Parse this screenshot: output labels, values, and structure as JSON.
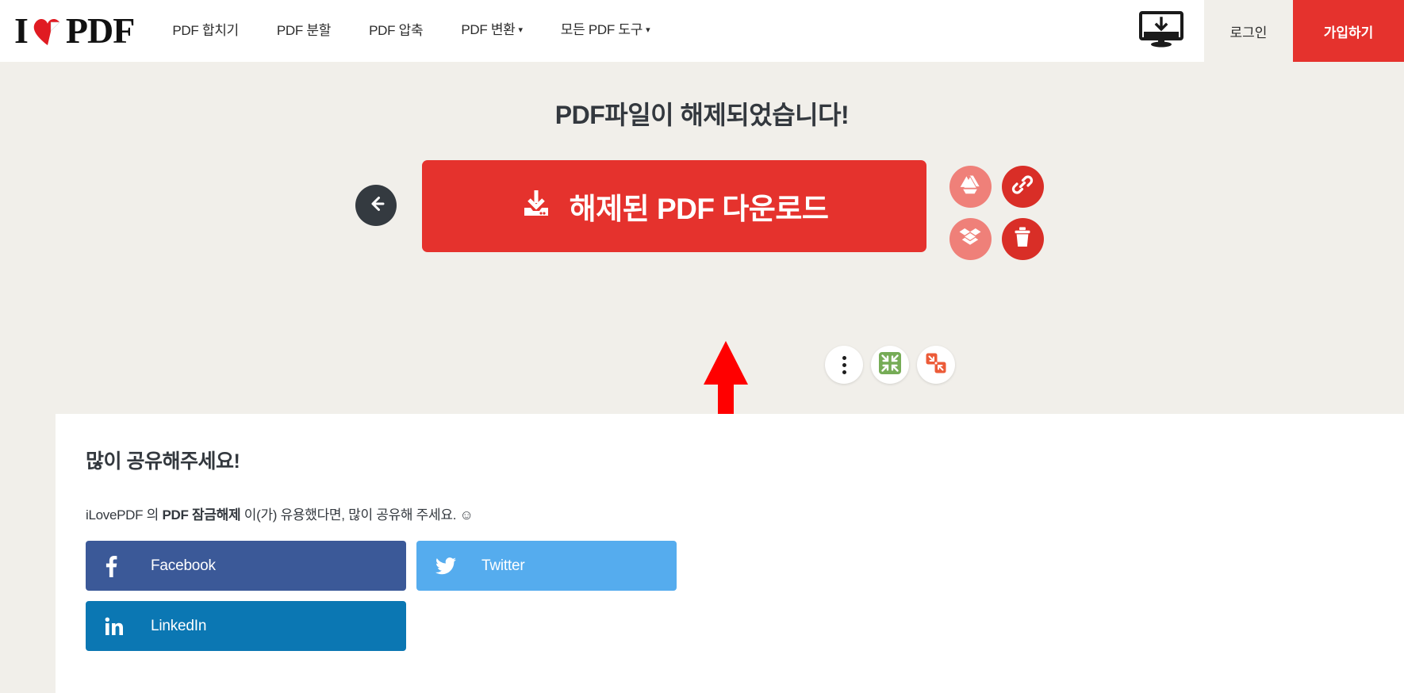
{
  "header": {
    "logo": {
      "pre": "I",
      "heart_icon": "heart-icon",
      "post": "PDF",
      "alt": "iLovePDF"
    },
    "nav": [
      {
        "label": "PDF 합치기",
        "caret": false
      },
      {
        "label": "PDF 분할",
        "caret": false
      },
      {
        "label": "PDF 압축",
        "caret": false
      },
      {
        "label": "PDF 변환",
        "caret": true
      },
      {
        "label": "모든 PDF 도구",
        "caret": true
      }
    ],
    "caret_glyph": "▾",
    "desktop_icon": "desktop-download-icon",
    "login_label": "로그인",
    "signup_label": "가입하기"
  },
  "main": {
    "title": "PDF파일이 해제되었습니다!",
    "back_icon": "arrow-left-icon",
    "download_label": "해제된 PDF 다운로드",
    "download_icon": "download-icon",
    "cloud_actions": [
      {
        "name": "google-drive-icon",
        "style": "light"
      },
      {
        "name": "link-icon",
        "style": "solid"
      },
      {
        "name": "dropbox-icon",
        "style": "light"
      },
      {
        "name": "trash-icon",
        "style": "solid"
      }
    ],
    "tool_actions": [
      {
        "name": "more-options-icon"
      },
      {
        "name": "compress-pdf-icon"
      },
      {
        "name": "merge-pdf-icon"
      }
    ],
    "annotation": {
      "name": "red-up-arrow-annotation",
      "color": "#FF0000"
    }
  },
  "share": {
    "title": "많이 공유해주세요!",
    "desc_part1": "iLovePDF 의 ",
    "desc_bold": "PDF 잠금해제",
    "desc_part2": " 이(가) 유용했다면, 많이 공유해 주세요. ☺",
    "buttons": [
      {
        "label": "Facebook",
        "icon": "facebook-icon",
        "color": "#3b5998"
      },
      {
        "label": "Twitter",
        "icon": "twitter-icon",
        "color": "#55acee"
      },
      {
        "label": "LinkedIn",
        "icon": "linkedin-icon",
        "color": "#0b77b3"
      }
    ]
  },
  "colors": {
    "brand_red": "#e5322d",
    "page_bg": "#f1efea",
    "card_bg": "#ffffff",
    "dark": "#343a40",
    "annotation_red": "#FF0000"
  }
}
